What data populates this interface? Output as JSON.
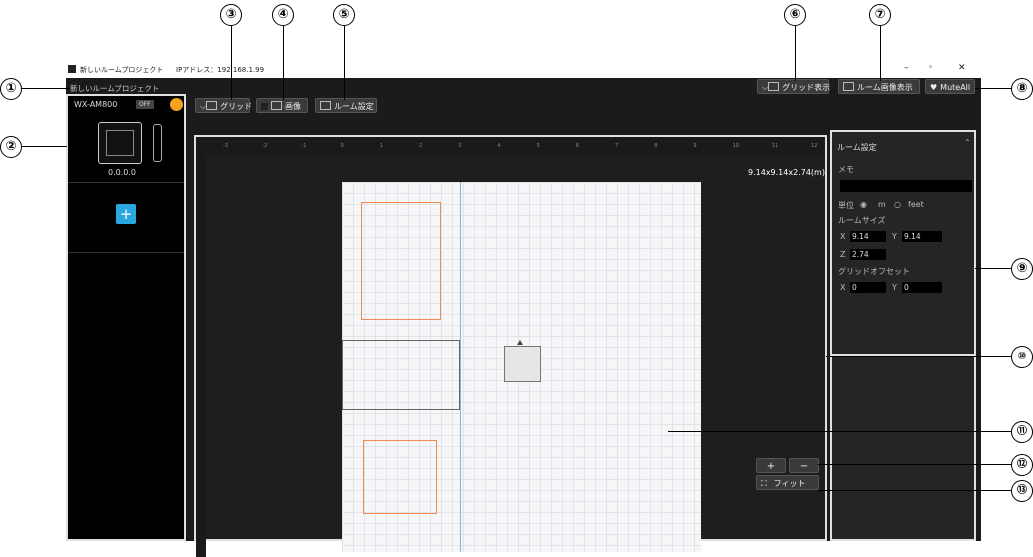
{
  "window": {
    "title": "新しいルームプロジェクト",
    "ip": "IPアドレス：192.168.1.99",
    "project_name": "新しいルームプロジェクト"
  },
  "toolbar": {
    "grid": "グリッド",
    "image": "画像",
    "room_settings": "ルーム設定",
    "grid_display": "グリッド表示",
    "room_image_display": "ルーム画像表示",
    "mute_all": "MuteAll"
  },
  "device": {
    "model": "WX-AM800",
    "status": "OFF",
    "ip": "0.0.0.0",
    "add": "+"
  },
  "ruler": {
    "ticks": [
      "-3",
      "-2",
      "-1",
      "0",
      "1",
      "2",
      "3",
      "4",
      "5",
      "6",
      "7",
      "8",
      "9",
      "10",
      "11",
      "12"
    ]
  },
  "canvas": {
    "size_label": "9.14x9.14x2.74(m)"
  },
  "room_panel": {
    "title": "ルーム設定",
    "memo_label": "メモ",
    "unit_label": "単位",
    "unit_m": "m",
    "unit_feet": "feet",
    "room_size_label": "ルームサイズ",
    "x_label": "X",
    "x_value": "9.14",
    "y_label": "Y",
    "y_value": "9.14",
    "z_label": "Z",
    "z_value": "2.74",
    "grid_offset_label": "グリッドオフセット",
    "offset_x_label": "X",
    "offset_x": "0",
    "offset_y_label": "Y",
    "offset_y": "0"
  },
  "zoom": {
    "plus": "+",
    "minus": "−",
    "fit": "フィット"
  },
  "callouts": [
    "①",
    "②",
    "③",
    "④",
    "⑤",
    "⑥",
    "⑦",
    "⑧",
    "⑨",
    "⑩",
    "⑪",
    "⑫",
    "⑬"
  ],
  "colors": {
    "accent_orange": "#f5a21d",
    "add_button": "#29a8e0",
    "room_box_orange": "#f08a50"
  }
}
